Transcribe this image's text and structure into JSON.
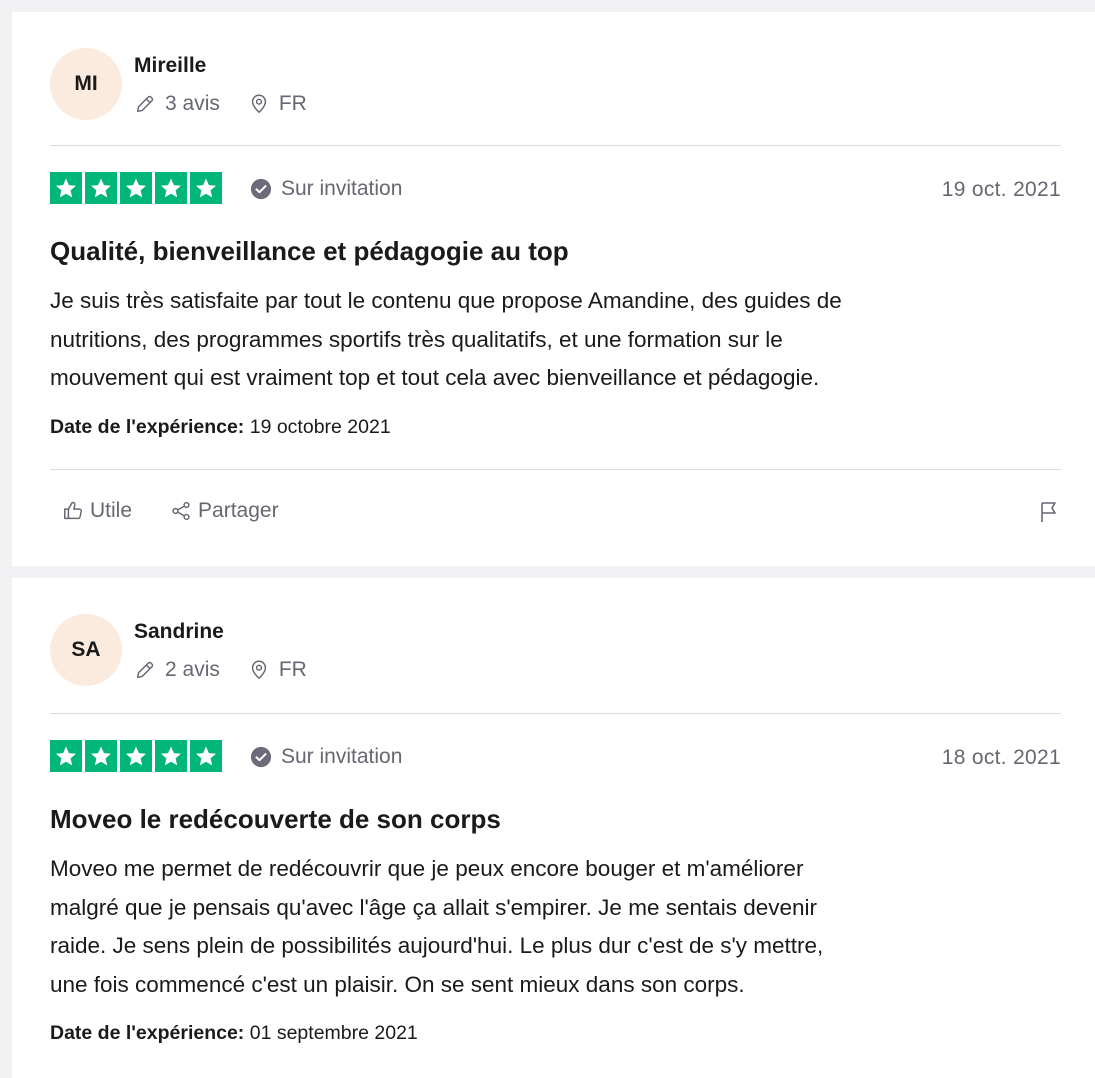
{
  "reviews": [
    {
      "initials": "MI",
      "name": "Mireille",
      "review_count": "3 avis",
      "country": "FR",
      "badge": "Sur invitation",
      "date": "19 oct. 2021",
      "title": "Qualité, bienveillance et pédagogie au top",
      "body_lines": [
        "Je suis très satisfaite par tout le contenu que propose Amandine, des guides de",
        "nutritions, des programmes sportifs très qualitatifs, et une formation sur le",
        "mouvement qui est vraiment top et tout cela avec bienveillance et pédagogie."
      ],
      "experience_label": "Date de l'expérience:",
      "experience_date": "19 octobre 2021",
      "rating": 5,
      "useful_label": "Utile",
      "share_label": "Partager"
    },
    {
      "initials": "SA",
      "name": "Sandrine",
      "review_count": "2 avis",
      "country": "FR",
      "badge": "Sur invitation",
      "date": "18 oct. 2021",
      "title": "Moveo le redécouverte de son corps",
      "body_lines": [
        "Moveo me permet de redécouvrir que je peux encore bouger et m'améliorer",
        "malgré que je pensais qu'avec l'âge ça allait s'empirer. Je me sentais devenir",
        "raide. Je sens plein de possibilités aujourd'hui. Le plus dur c'est de s'y mettre,",
        "une fois commencé c'est un plaisir. On se sent mieux dans son corps."
      ],
      "experience_label": "Date de l'expérience:",
      "experience_date": "01 septembre 2021",
      "rating": 5
    }
  ],
  "icons": {
    "pencil": "pencil-icon",
    "location": "location-pin-icon",
    "verified": "check-circle-icon",
    "star": "star-icon",
    "thumb": "thumbs-up-icon",
    "share": "share-icon",
    "flag": "flag-icon"
  },
  "colors": {
    "star_green": "#00b67a",
    "avatar_bg": "#fbeade",
    "muted_text": "#676773",
    "page_bg": "#f1f1f3"
  }
}
